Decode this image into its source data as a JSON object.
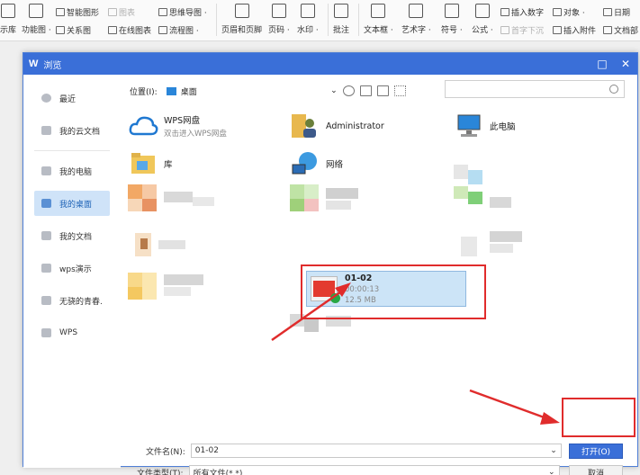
{
  "ribbon": {
    "small": [
      {
        "id": "smartart",
        "label": "智能图形"
      },
      {
        "id": "chart",
        "label": "图表",
        "dim": true
      },
      {
        "id": "mindmap",
        "label": "思维导图 ·"
      },
      {
        "id": "relation",
        "label": "关系图"
      },
      {
        "id": "onlinechart",
        "label": "在线图表"
      },
      {
        "id": "flowchart",
        "label": "流程图 ·"
      },
      {
        "id": "insertnum",
        "label": "插入数字"
      },
      {
        "id": "object",
        "label": "对象 ·"
      },
      {
        "id": "date",
        "label": "日期"
      },
      {
        "id": "firstsink",
        "label": "首字下沉",
        "dim": true
      },
      {
        "id": "attach",
        "label": "插入附件"
      },
      {
        "id": "docpart",
        "label": "文档部"
      }
    ],
    "big": [
      {
        "id": "lib",
        "label": "示库"
      },
      {
        "id": "funcmap",
        "label": "功能图 ·"
      },
      {
        "id": "headerfooter",
        "label": "页眉和页脚"
      },
      {
        "id": "pagenum",
        "label": "页码 ·"
      },
      {
        "id": "watermark",
        "label": "水印 ·"
      },
      {
        "id": "comment",
        "label": "批注"
      },
      {
        "id": "textbox",
        "label": "文本框 ·"
      },
      {
        "id": "arttext",
        "label": "艺术字 ·"
      },
      {
        "id": "symbol",
        "label": "符号 ·"
      },
      {
        "id": "formula",
        "label": "公式 ·"
      }
    ]
  },
  "dialog": {
    "logo": "W",
    "title": "浏览",
    "sidebar": [
      "最近",
      "我的云文档",
      "我的电脑",
      "我的桌面",
      "我的文档",
      "wps演示",
      "无骁的青春.",
      "WPS"
    ],
    "location_label": "位置(I):",
    "location_value": "桌面",
    "search_placeholder": "",
    "items": {
      "wps_drive_name": "WPS网盘",
      "wps_drive_sub": "双击进入WPS网盘",
      "admin": "Administrator",
      "thispc": "此电脑",
      "library": "库",
      "network": "网络"
    },
    "selected_file": {
      "name": "01-02",
      "duration": "00:00:13",
      "size": "12.5 MB"
    },
    "filename_label": "文件名(N):",
    "filename_value": "01-02",
    "filetype_label": "文件类型(T):",
    "filetype_value": "所有文件(*.*)",
    "open_label": "打开(O)",
    "cancel_label": "取消"
  },
  "colors": {
    "accent": "#3a6fd8",
    "selection": "#cce4f7",
    "annotation": "#e02c2c"
  }
}
